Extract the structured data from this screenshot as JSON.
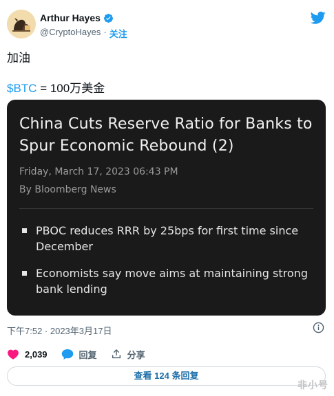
{
  "author": {
    "name": "Arthur Hayes",
    "handle": "@CryptoHayes",
    "separator": "·",
    "follow_label": "关注"
  },
  "tweet": {
    "line1": "加油",
    "cashtag": "$BTC",
    "line2_rest": " = 100万美金"
  },
  "card": {
    "title": "China Cuts Reserve Ratio for Banks to Spur Economic Rebound (2)",
    "date": "Friday, March 17, 2023 06:43 PM",
    "byline": "By Bloomberg News",
    "bullets": [
      "PBOC reduces RRR by 25bps for first time since December",
      "Economists say move aims at maintaining strong bank lending"
    ]
  },
  "timestamp": "下午7:52 · 2023年3月17日",
  "actions": {
    "likes_count": "2,039",
    "reply_label": "回复",
    "share_label": "分享"
  },
  "view_replies_label": "查看 124 条回复",
  "watermark": "非小号",
  "colors": {
    "accent": "#1d9bf0",
    "like": "#f91880",
    "card_bg": "#1a1a1a"
  },
  "icons": [
    "verified-badge-icon",
    "twitter-bird-icon",
    "info-icon",
    "heart-icon",
    "reply-bubble-icon",
    "share-icon"
  ]
}
